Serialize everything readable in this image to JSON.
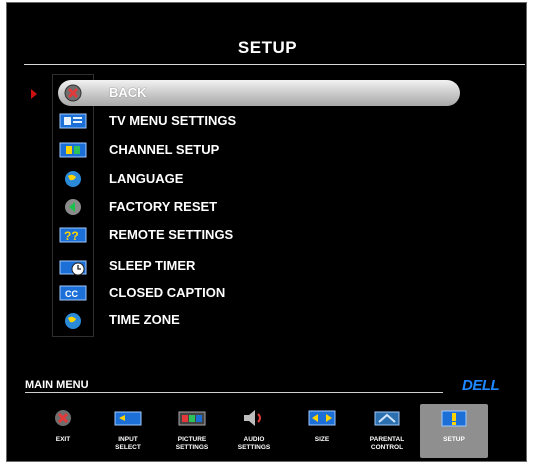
{
  "screen": {
    "title": "SETUP"
  },
  "menu": {
    "items": [
      {
        "label": "BACK",
        "icon": "back-x-icon",
        "selected": true
      },
      {
        "label": "TV MENU SETTINGS",
        "icon": "tv-menu-icon"
      },
      {
        "label": "CHANNEL SETUP",
        "icon": "channel-icon"
      },
      {
        "label": "LANGUAGE",
        "icon": "globe-icon"
      },
      {
        "label": "FACTORY RESET",
        "icon": "reset-icon"
      },
      {
        "label": "REMOTE SETTINGS",
        "icon": "remote-icon"
      },
      {
        "label": "SLEEP TIMER",
        "icon": "sleep-timer-icon"
      },
      {
        "label": "CLOSED CAPTION",
        "icon": "cc-icon"
      },
      {
        "label": "TIME ZONE",
        "icon": "globe-icon"
      }
    ]
  },
  "footer": {
    "main_menu_label": "MAIN MENU",
    "brand": "DELL",
    "items": [
      {
        "label": "EXIT",
        "icon": "exit-icon"
      },
      {
        "label": "INPUT\nSELECT",
        "icon": "input-icon"
      },
      {
        "label": "PICTURE\nSETTINGS",
        "icon": "picture-icon"
      },
      {
        "label": "AUDIO\nSETTINGS",
        "icon": "speaker-icon"
      },
      {
        "label": "SIZE",
        "icon": "size-icon"
      },
      {
        "label": "PARENTAL\nCONTROL",
        "icon": "parental-icon"
      },
      {
        "label": "SETUP",
        "icon": "setup-icon",
        "active": true
      }
    ]
  },
  "colors": {
    "accent_blue": "#1d88ff",
    "highlight": "#c8c8c8",
    "marker_red": "#cc1010"
  }
}
